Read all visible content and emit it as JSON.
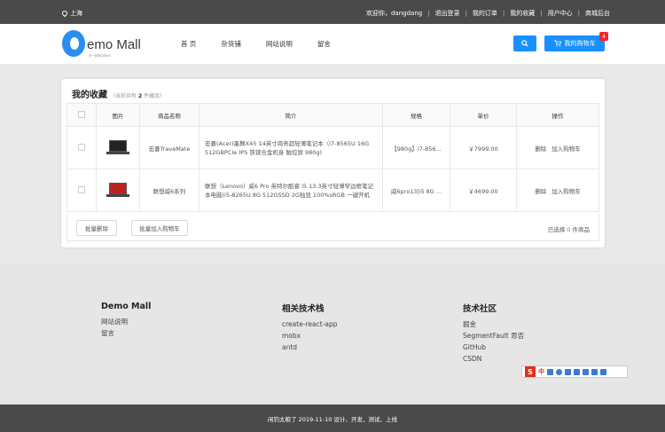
{
  "topbar": {
    "location": "上海",
    "links": [
      "欢迎你，dangdang",
      "退出登录",
      "我的订单",
      "我的收藏",
      "用户中心",
      "商城后台"
    ]
  },
  "header": {
    "logo_text": "emo Mall",
    "logo_sub": "不一样的DEMO",
    "nav": [
      "首 页",
      "杂货铺",
      "网站说明",
      "留言"
    ],
    "cart_label": "我的购物车",
    "cart_count": "4"
  },
  "favorites": {
    "title": "我的收藏",
    "count_prefix": "（当前共有",
    "count": "2",
    "count_suffix": "件藏品）",
    "columns": [
      "图片",
      "商品名称",
      "简介",
      "规格",
      "单价",
      "操作"
    ],
    "rows": [
      {
        "name": "宏碁TraveMate",
        "desc": "宏碁(Acer)墨舞X45 14英寸商务超轻薄笔记本（i7-8565U 16G 512GBPCIe IPS 铁镁合金机身 触控屏 980g)",
        "spec": "【980g】i7-856...",
        "price": "￥7999.00",
        "op_delete": "删除",
        "op_cart": "加入购物车"
      },
      {
        "name": "联想威6系列",
        "desc": "联想（Lenovo）威6 Pro 英特尔酷睿 i5 13.3英寸轻薄窄边框笔记本电脑(i5-8265U 8G 512GSSD 2G独显 100%sRGB 一键开机",
        "spec": "威6pro13|i5 8G ...",
        "price": "￥4699.00",
        "op_delete": "删除",
        "op_cart": "加入购物车"
      }
    ],
    "batch_delete": "批量删除",
    "batch_cart": "批量加入购物车",
    "selected_prefix": "已选择",
    "selected_count": "0",
    "selected_suffix": "件商品"
  },
  "footer": {
    "col1_title": "Demo Mall",
    "col1_items": [
      "网站说明",
      "留言"
    ],
    "col2_title": "相关技术栈",
    "col2_items": [
      "create-react-app",
      "mobx",
      "antd"
    ],
    "col3_title": "技术社区",
    "col3_items": [
      "掘金",
      "SegmentFault 思否",
      "GitHub",
      "CSDN"
    ],
    "copyright": "闲钓太粮了 2019-11-10 设计、开发、测试、上线"
  },
  "ime": {
    "logo": "S",
    "mode": "中"
  },
  "colors": {
    "primary": "#1890ff",
    "badge": "#f5222d",
    "topbar": "#4a4a4a"
  }
}
